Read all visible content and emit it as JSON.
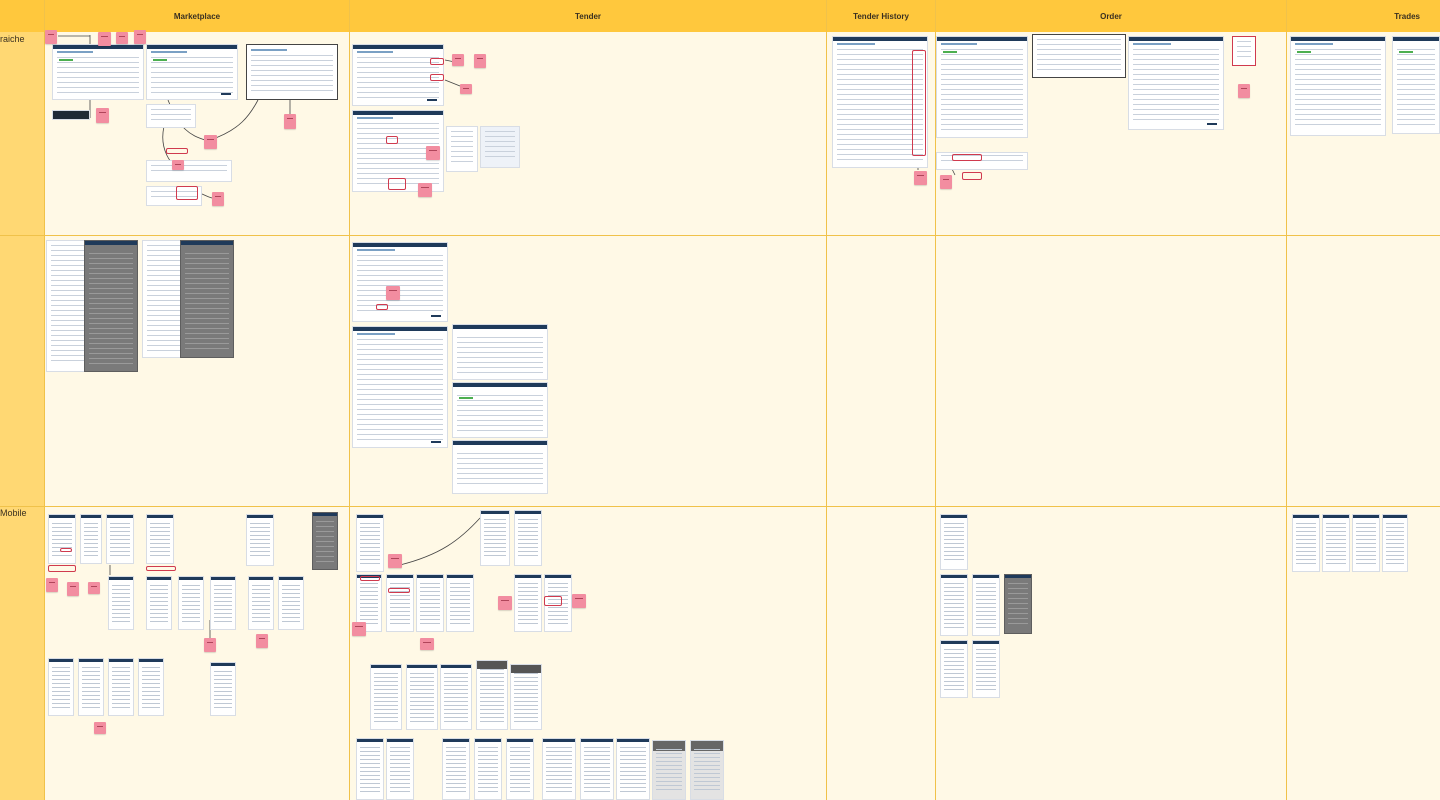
{
  "board": {
    "columns": [
      {
        "id": "marketplace",
        "label": "Marketplace"
      },
      {
        "id": "tender",
        "label": "Tender"
      },
      {
        "id": "tender-history",
        "label": "Tender History"
      },
      {
        "id": "order",
        "label": "Order"
      },
      {
        "id": "trades",
        "label": "Trades"
      }
    ],
    "rows": [
      {
        "id": "fraiche",
        "label": "raiche"
      },
      {
        "id": "middle",
        "label": ""
      },
      {
        "id": "mobile",
        "label": "Mobile"
      }
    ]
  },
  "colors": {
    "header": "#FFC83D",
    "board": "#FFF9E6",
    "row_label_strip": "#FFD873",
    "grid_lines": "#F0C24A",
    "sticky_note": "#F28DA0",
    "highlight": "#D03A4E",
    "wireframe_nav": "#1F3A5A"
  }
}
